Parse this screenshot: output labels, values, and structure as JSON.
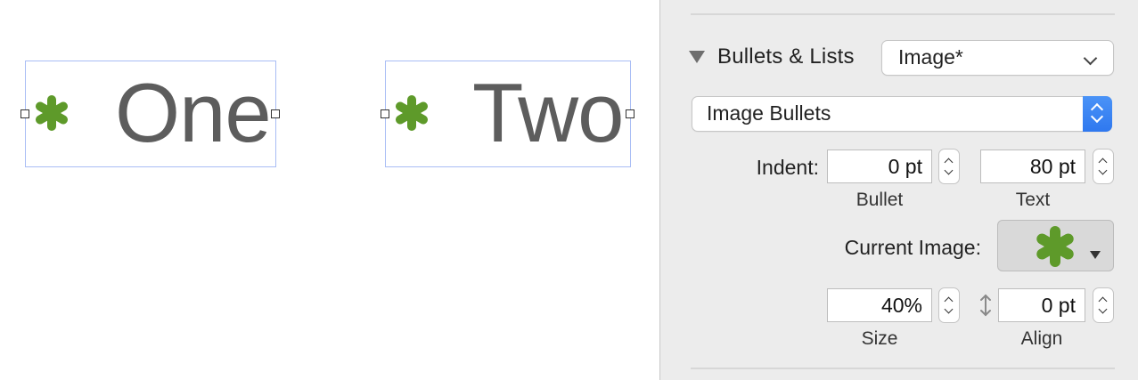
{
  "canvas": {
    "boxes": [
      {
        "text": "One"
      },
      {
        "text": "Two"
      }
    ],
    "bullet_color": "#5e9a2a",
    "text_color": "#5d5d5d",
    "selection_color": "#a9bdf5"
  },
  "inspector": {
    "section_title": "Bullets & Lists",
    "preset_value": "Image*",
    "bullet_type": "Image Bullets",
    "indent_label": "Indent:",
    "bullet_indent": "0 pt",
    "text_indent": "80 pt",
    "bullet_sublabel": "Bullet",
    "text_sublabel": "Text",
    "current_image_label": "Current Image:",
    "size_value": "40%",
    "align_value": "0 pt",
    "size_sublabel": "Size",
    "align_sublabel": "Align",
    "accent_color": "#2f78ef"
  }
}
